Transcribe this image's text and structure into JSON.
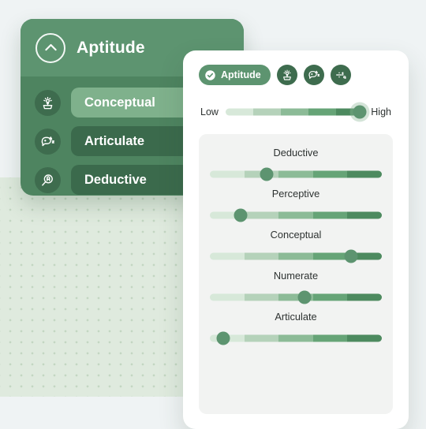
{
  "theme": {
    "page_background": "#eff3f4",
    "brand_green": "#5d9470",
    "card_green": "#4e8460",
    "dark_green": "#3b6a4c",
    "active_pill_green": "#7fb18c",
    "panel_grey": "#f2f3f2",
    "dot_panel_green": "#dfeade"
  },
  "green_card": {
    "logo_icon": "chevron-up-circle-icon",
    "title": "Aptitude",
    "items": [
      {
        "label": "Conceptual",
        "icon": "plant-idea-icon",
        "active": true
      },
      {
        "label": "Articulate",
        "icon": "speech-bubble-icon",
        "active": false
      },
      {
        "label": "Deductive",
        "icon": "magnifier-icon",
        "active": false
      }
    ]
  },
  "white_card": {
    "tabs": [
      {
        "label": "Aptitude",
        "icon": "check-circle-icon",
        "type": "pill",
        "selected": true
      },
      {
        "label": "Conceptual",
        "icon": "plant-idea-icon",
        "type": "icon",
        "selected": false
      },
      {
        "label": "Articulate",
        "icon": "speech-bubble-icon",
        "type": "icon",
        "selected": false
      },
      {
        "label": "Numerate",
        "icon": "math-divide-icon",
        "type": "icon",
        "selected": false
      }
    ],
    "legend": {
      "low_label": "Low",
      "high_label": "High",
      "value_percent": 97
    },
    "sliders": [
      {
        "label": "Deductive",
        "value_percent": 33
      },
      {
        "label": "Perceptive",
        "value_percent": 18
      },
      {
        "label": "Conceptual",
        "value_percent": 82
      },
      {
        "label": "Numerate",
        "value_percent": 55
      },
      {
        "label": "Articulate",
        "value_percent": 8
      }
    ],
    "track_colors": [
      "#d7e8d9",
      "#b5d2ba",
      "#8cbb97",
      "#66a477",
      "#4d8a5f"
    ]
  }
}
